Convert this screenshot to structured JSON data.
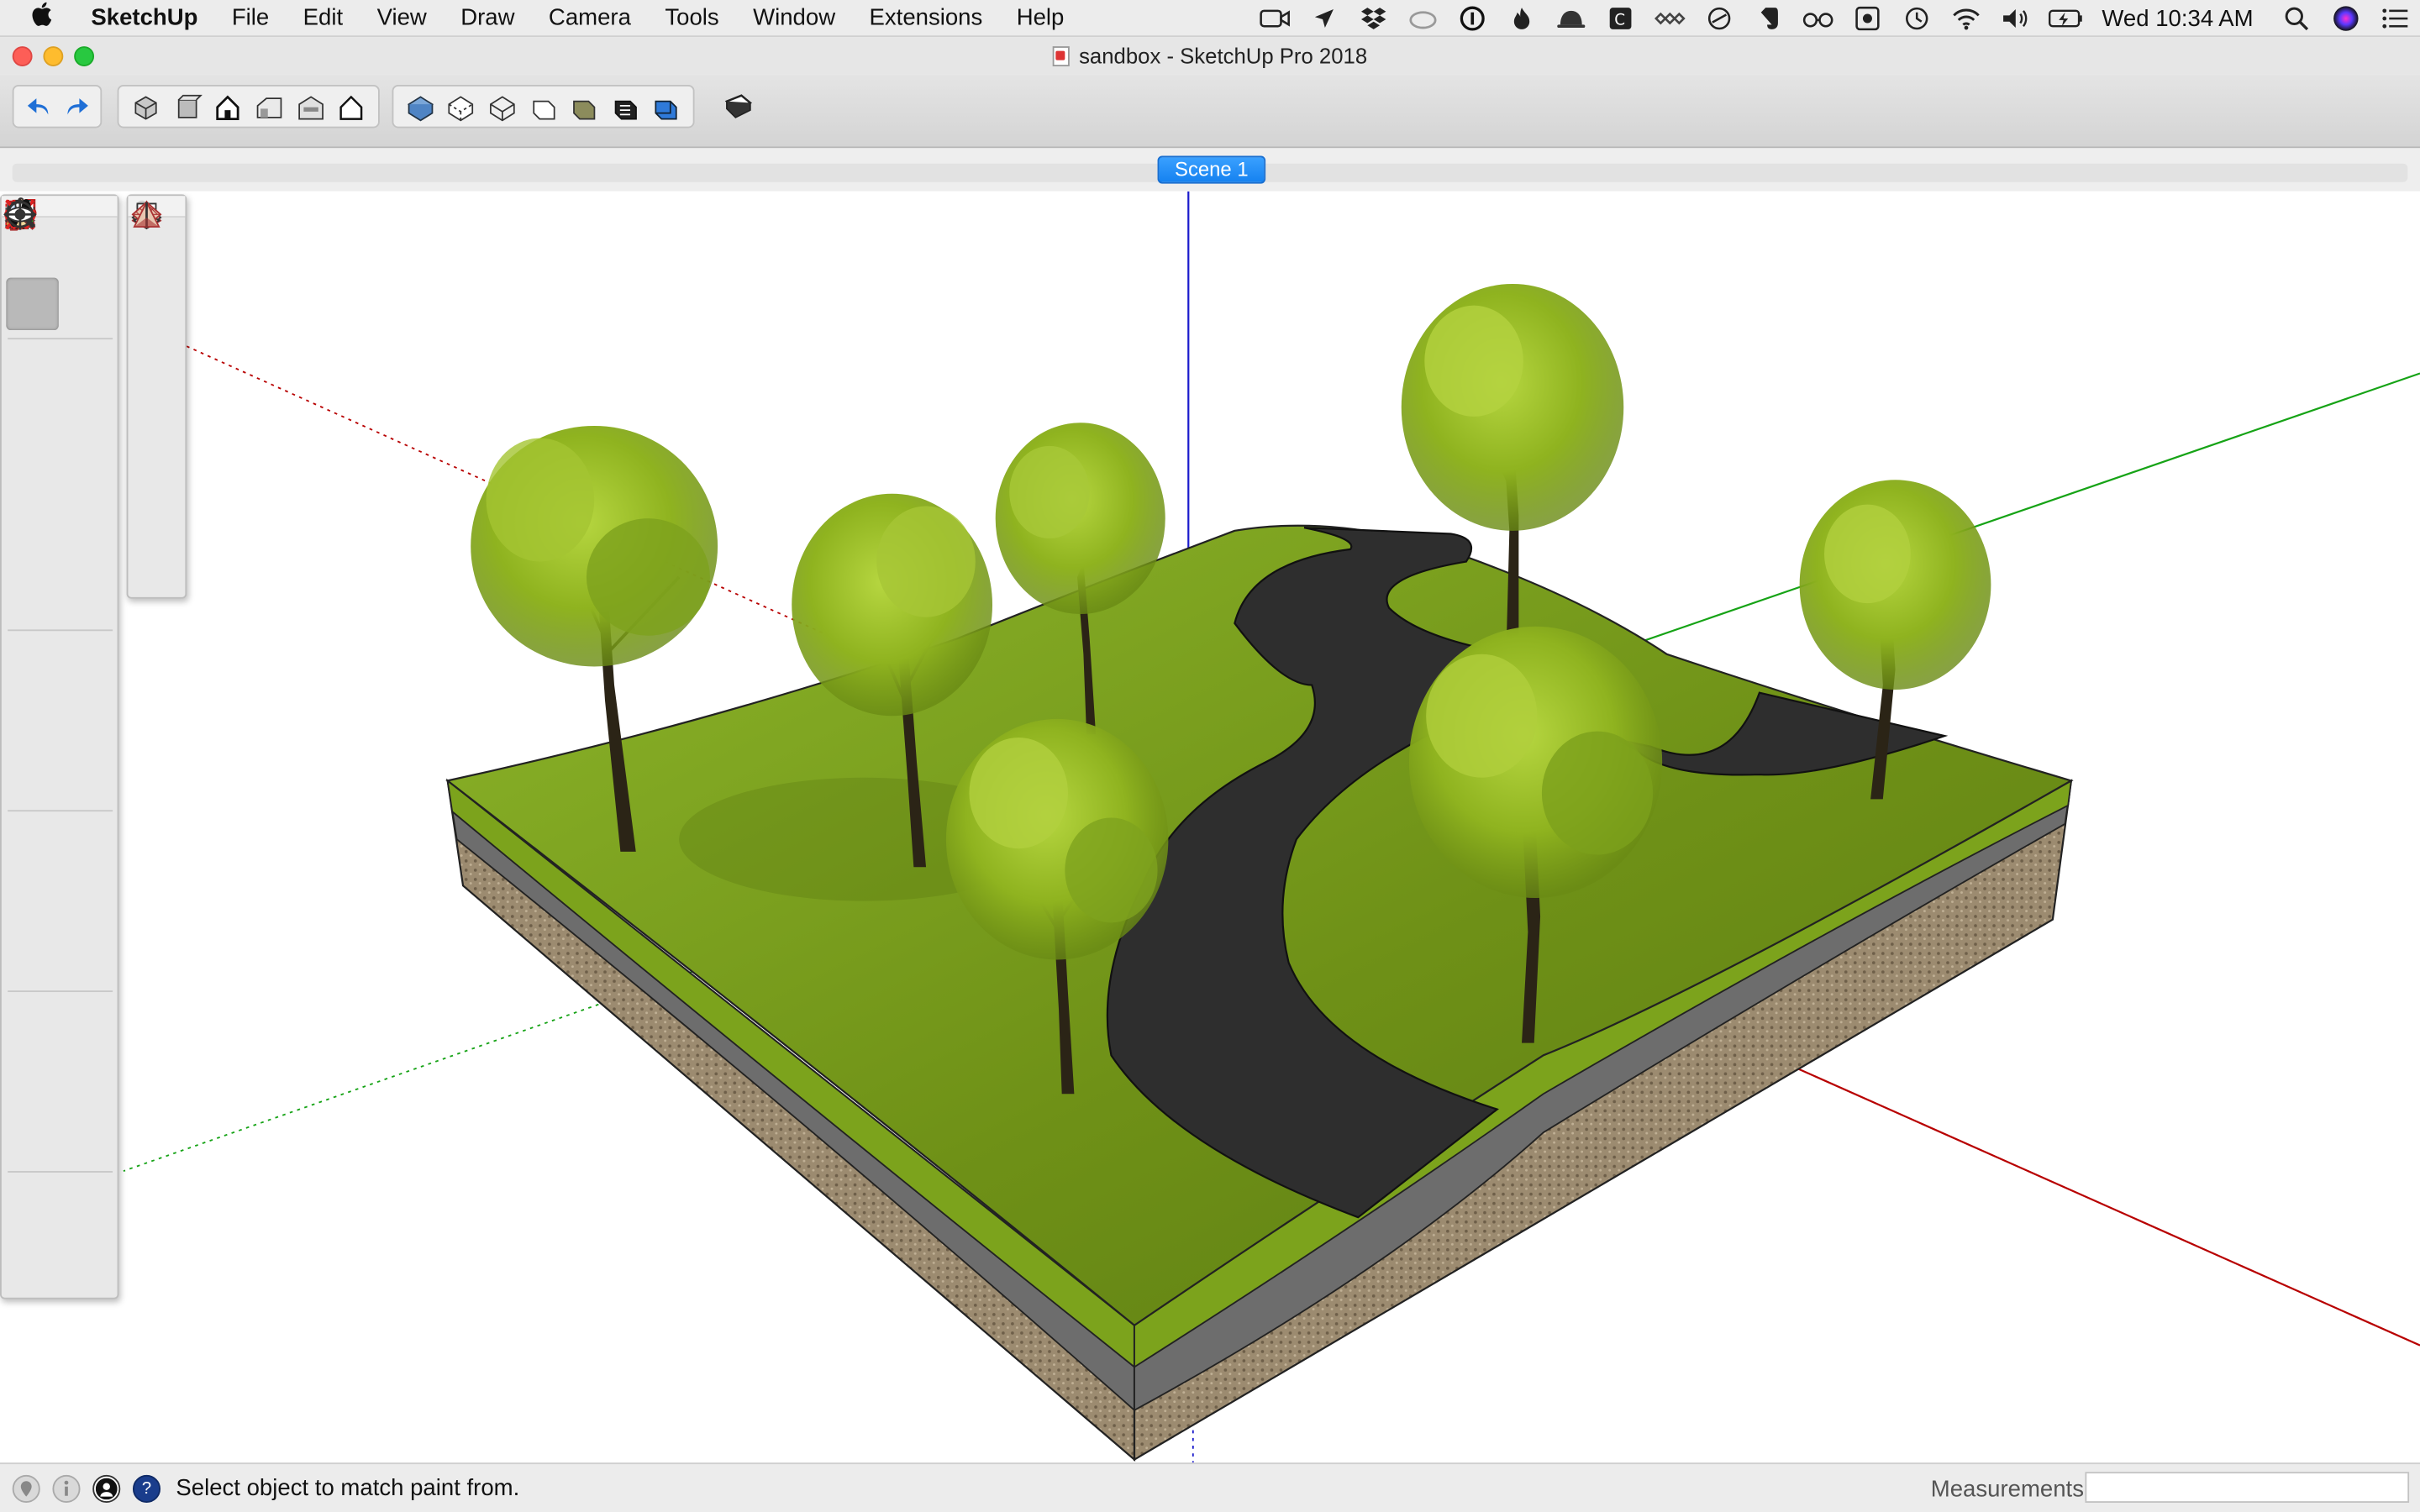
{
  "menubar": {
    "apple": "",
    "app_name": "SketchUp",
    "items": [
      "File",
      "Edit",
      "View",
      "Draw",
      "Camera",
      "Tools",
      "Window",
      "Extensions",
      "Help"
    ],
    "clock": "Wed 10:34 AM"
  },
  "window": {
    "title": "sandbox - SketchUp Pro 2018"
  },
  "scenes": {
    "active_tab": "Scene 1"
  },
  "statusbar": {
    "message": "Select object to match paint from.",
    "measurements_label": "Measurements",
    "measurements_value": ""
  },
  "colors": {
    "accent": "#1582f0",
    "grass": "#7a9a1c",
    "road": "#2e2e2e",
    "soil": "#9b8a70",
    "axis_red": "#b80000",
    "axis_green": "#16a316",
    "axis_blue": "#1a1acc"
  }
}
